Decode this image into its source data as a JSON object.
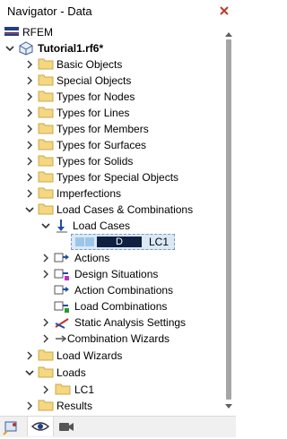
{
  "window": {
    "title": "Navigator - Data"
  },
  "root": {
    "label": "RFEM"
  },
  "file": {
    "label": "Tutorial1.rf6*"
  },
  "tree": {
    "basic_objects": "Basic Objects",
    "special_objects": "Special Objects",
    "types_nodes": "Types for Nodes",
    "types_lines": "Types for Lines",
    "types_members": "Types for Members",
    "types_surfaces": "Types for Surfaces",
    "types_solids": "Types for Solids",
    "types_special": "Types for Special Objects",
    "imperfections": "Imperfections",
    "load_cases_combinations": "Load Cases & Combinations",
    "load_cases": "Load Cases",
    "lc1_badge": "D",
    "lc1_name": "LC1",
    "actions": "Actions",
    "design_situations": "Design Situations",
    "action_combinations": "Action Combinations",
    "load_combinations": "Load Combinations",
    "static_analysis_settings": "Static Analysis Settings",
    "combination_wizards": "Combination Wizards",
    "load_wizards": "Load Wizards",
    "loads": "Loads",
    "loads_lc1": "LC1",
    "results": "Results"
  },
  "colors": {
    "folder": "#f4d77e",
    "folder_edge": "#c9a94f",
    "selection_bg": "#dbe8f6",
    "badge_bg": "#102040"
  },
  "icons": {
    "close": "close-x-icon",
    "rfem": "rfem-flag-icon",
    "file": "model-file-icon",
    "folder": "folder-icon",
    "data_tab": "eye-icon",
    "view_tab": "camera-icon",
    "navigator": "navigator-pin-icon"
  }
}
